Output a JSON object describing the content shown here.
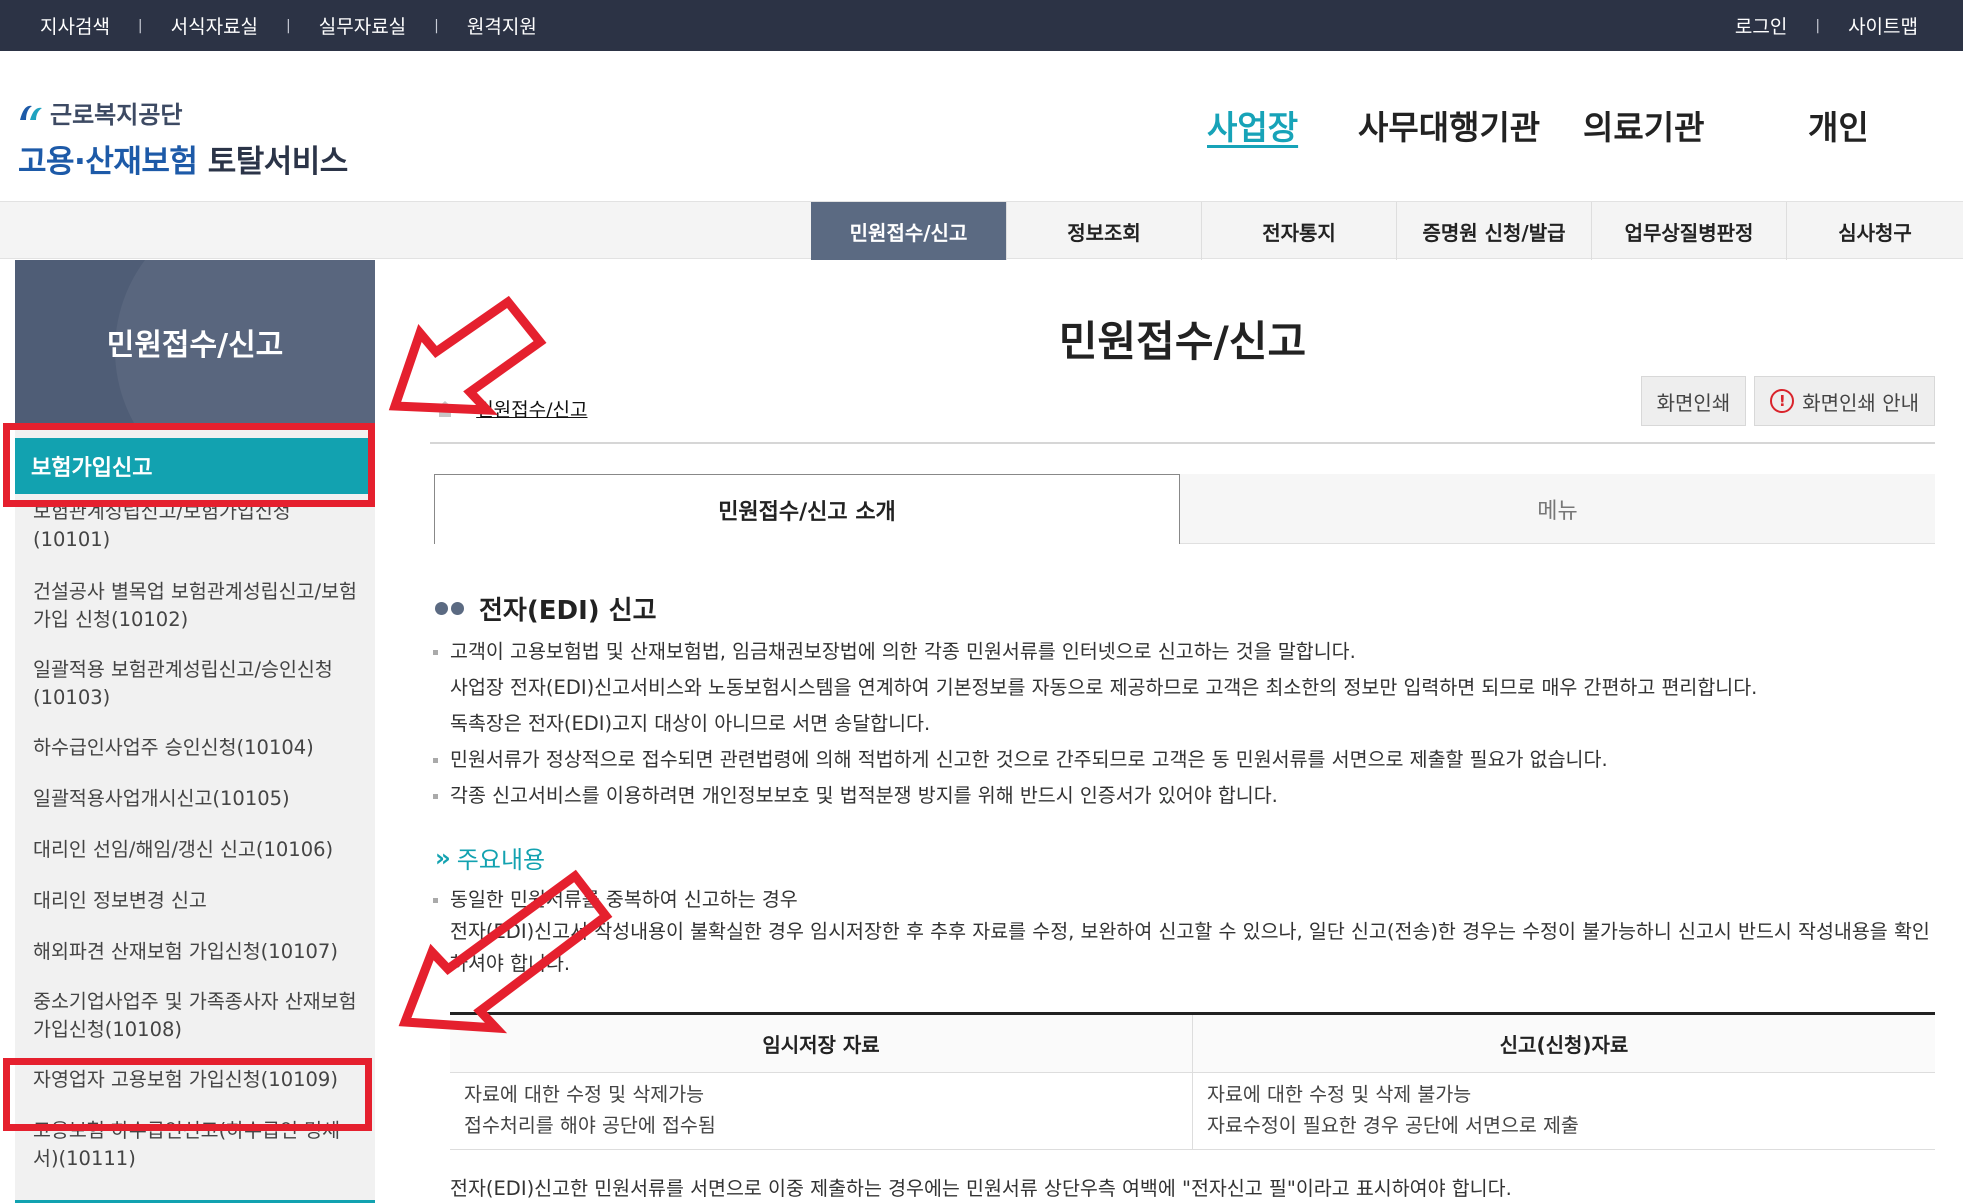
{
  "topbar": {
    "left_links": [
      "지사검색",
      "서식자료실",
      "실무자료실",
      "원격지원"
    ],
    "right_links": [
      "로그인",
      "사이트맵"
    ],
    "separator": "|"
  },
  "logo": {
    "org_name": "근로복지공단",
    "service_name_main": "고용·산재보험",
    "service_name_tail": "토탈서비스"
  },
  "main_nav": [
    "사업장",
    "사무대행기관",
    "의료기관",
    "개인"
  ],
  "sub_nav": [
    "민원접수/신고",
    "정보조회",
    "전자통지",
    "증명원 신청/발급",
    "업무상질병판정",
    "심사청구"
  ],
  "sidebar": {
    "title": "민원접수/신고",
    "active_item": "보험가입신고",
    "items": [
      "보험관계성립신고/보험가입신청(10101)",
      "건설공사 별목업 보험관계성립신고/보험가입 신청(10102)",
      "일괄적용 보험관계성립신고/승인신청(10103)",
      "하수급인사업주 승인신청(10104)",
      "일괄적용사업개시신고(10105)",
      "대리인 선임/해임/갱신 신고(10106)",
      "대리인 정보변경 신고",
      "해외파견 산재보험 가입신청(10107)",
      "중소기업사업주 및 가족종사자 산재보험가입신청(10108)",
      "자영업자 고용보험 가입신청(10109)",
      "고용보험 하수급인신고(하수급인 명세서)(10111)"
    ]
  },
  "content": {
    "page_title": "민원접수/신고",
    "breadcrumb_current": "민원접수/신고",
    "print_button": "화면인쇄",
    "print_guide_button": "화면인쇄 안내",
    "tabs": [
      "민원접수/신고 소개",
      "메뉴"
    ],
    "section_title": "전자(EDI) 신고",
    "paragraphs": [
      "고객이 고용보험법 및 산재보험법, 임금채권보장법에 의한 각종 민원서류를 인터넷으로 신고하는 것을 말합니다.",
      "사업장 전자(EDI)신고서비스와 노동보험시스템을 연계하여 기본정보를 자동으로 제공하므로 고객은 최소한의 정보만 입력하면 되므로 매우 간편하고 편리합니다.",
      "독촉장은 전자(EDI)고지 대상이 아니므로 서면 송달합니다.",
      "민원서류가 정상적으로 접수되면 관련법령에 의해 적법하게 신고한 것으로 간주되므로 고객은 동 민원서류를 서면으로 제출할 필요가 없습니다.",
      "각종 신고서비스를 이용하려면 개인정보보호 및 법적분쟁 방지를 위해 반드시 인증서가 있어야 합니다."
    ],
    "subsection_title": "주요내용",
    "sub_paragraphs": [
      "동일한 민원서류를 중복하여 신고하는 경우",
      "전자(EDI)신고서 작성내용이 불확실한 경우 임시저장한 후 추후 자료를 수정, 보완하여 신고할 수 있으나, 일단 신고(전송)한 경우는 수정이 불가능하니 신고시 반드시 작성내용을 확인하셔야 합니다."
    ],
    "table": {
      "headers": [
        "임시저장 자료",
        "신고(신청)자료"
      ],
      "col1": [
        "자료에 대한 수정 및 삭제가능",
        "접수처리를 해야 공단에 접수됨"
      ],
      "col2": [
        "자료에 대한 수정 및 삭제 불가능",
        "자료수정이 필요한 경우 공단에 서면으로 제출"
      ]
    },
    "bottom_note": "전자(EDI)신고한 민원서류를 서면으로 이중 제출하는 경우에는 민원서류 상단우측 여백에 \"전자신고 필\"이라고 표시하여야 합니다."
  },
  "colors": {
    "topbar_bg": "#2c3345",
    "accent_teal": "#12a2b0",
    "nav_active_text": "#17a3b8",
    "subnav_active_bg": "#5b6a82",
    "sidebar_title_bg": "#4f5d76",
    "annotation_red": "#e5202e",
    "logo_blue": "#1d5aa8"
  },
  "icons": [
    "home-icon",
    "breadcrumb-chevron-icon",
    "alert-icon",
    "section-dots-icon",
    "double-chevron-icon",
    "logo-mark-icon"
  ]
}
